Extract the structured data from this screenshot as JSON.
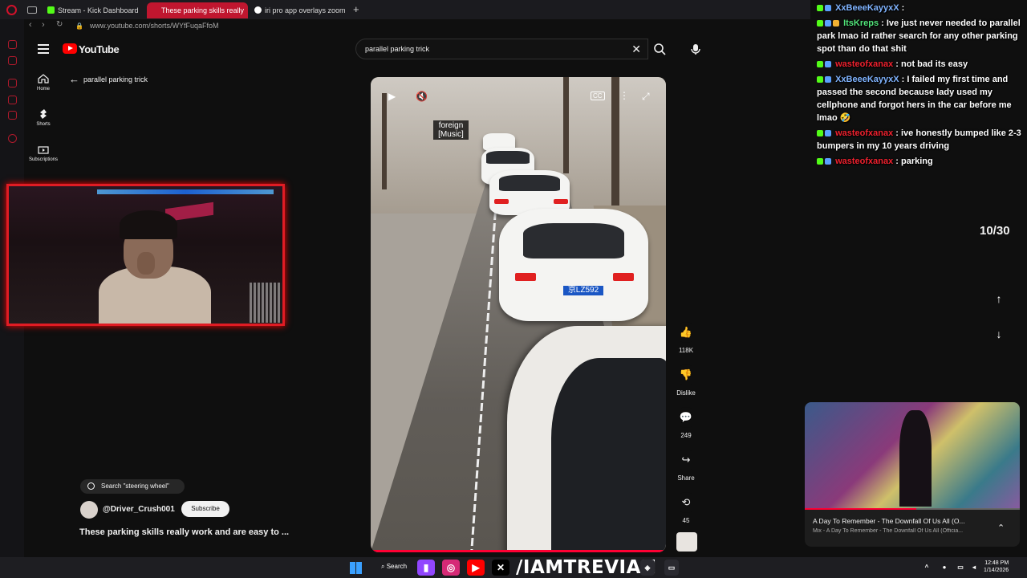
{
  "browser": {
    "tabs": [
      {
        "label": "Stream - Kick Dashboard",
        "active": false,
        "favicon_color": "#53fc18"
      },
      {
        "label": "These parking skills really",
        "active": true,
        "favicon_color": "#ff0000"
      },
      {
        "label": "iri pro app overlays zoom",
        "active": false,
        "favicon_color": "#ffffff"
      }
    ],
    "url": "www.youtube.com/shorts/WYfFuqaFfoM"
  },
  "youtube": {
    "logo_text": "YouTube",
    "search_value": "parallel parking trick",
    "nav": [
      {
        "label": "Home",
        "icon": "home-icon"
      },
      {
        "label": "Shorts",
        "icon": "shorts-icon"
      },
      {
        "label": "Subscriptions",
        "icon": "subscriptions-icon"
      }
    ],
    "back_label": "parallel parking trick"
  },
  "video": {
    "caption_line1": "foreign",
    "caption_line2": "[Music]",
    "cc_label": "CC",
    "plate_text": "京LZ592"
  },
  "actions": [
    {
      "icon": "like-icon",
      "label": "118K"
    },
    {
      "icon": "dislike-icon",
      "label": "Dislike"
    },
    {
      "icon": "comment-icon",
      "label": "249"
    },
    {
      "icon": "share-icon",
      "label": "Share"
    },
    {
      "icon": "remix-icon",
      "label": "45"
    }
  ],
  "short_info": {
    "search_pill": "Search \"steering wheel\"",
    "channel": "@Driver_Crush001",
    "subscribe": "Subscribe",
    "title": "These parking skills really work and are easy to ..."
  },
  "chat": [
    {
      "user": "XxBeeeKayyxX",
      "color": "blue",
      "message": ""
    },
    {
      "user": "ItsKreps",
      "color": "green",
      "message": "Ive just never needed to parallel park lmao id rather search for any other parking spot than do that shit"
    },
    {
      "user": "wasteofxanax",
      "color": "red",
      "message": "not bad its easy"
    },
    {
      "user": "XxBeeeKayyxX",
      "color": "blue",
      "message": "I failed my first time and passed the second because lady used my cellphone and forgot hers in the car before me lmao 🤣"
    },
    {
      "user": "wasteofxanax",
      "color": "red",
      "message": "ive honestly bumped like 2-3 bumpers in my 10 years driving"
    },
    {
      "user": "wasteofxanax",
      "color": "red",
      "message": "parking"
    }
  ],
  "counter": "10/30",
  "music": {
    "title": "A Day To Remember - The Downfall Of Us All (O...",
    "subtitle": "Mix - A Day To Remember - The Downfall Of Us All (Officia...",
    "progress": 0.52
  },
  "taskbar": {
    "search_label": "Search",
    "brand": "/IAMTREVIAN",
    "time": "12:48 PM",
    "date": "1/14/2026"
  }
}
